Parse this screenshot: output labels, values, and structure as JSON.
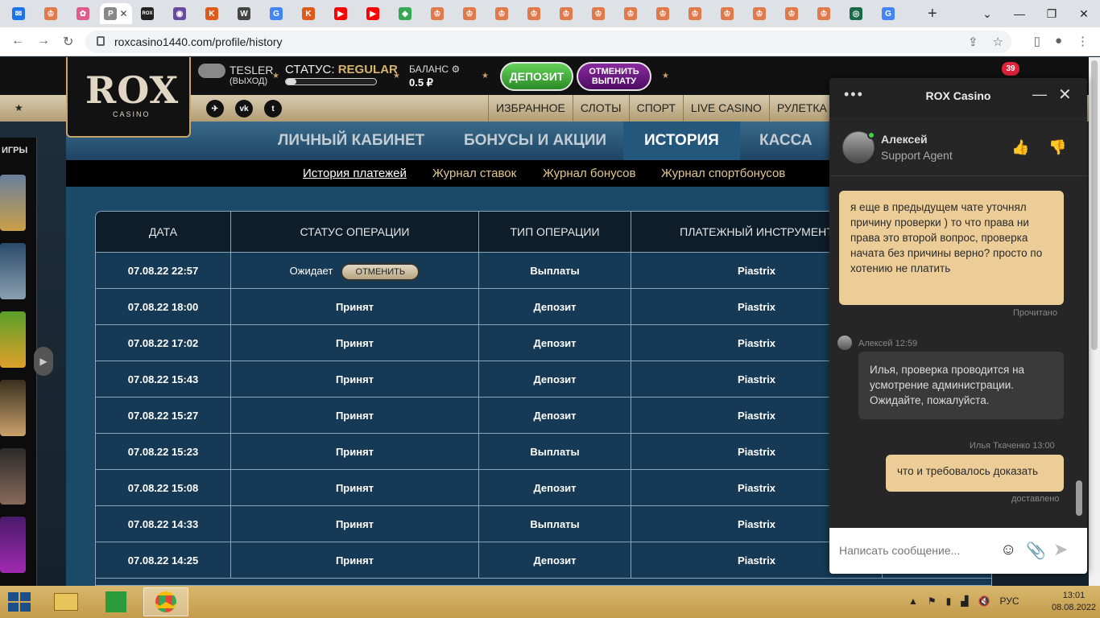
{
  "browser": {
    "tabs": [
      {
        "icon": "mail-icon",
        "color": "#1a73e8",
        "glyph": "✉"
      },
      {
        "icon": "crown-icon",
        "color": "#e07a4a",
        "glyph": "♔"
      },
      {
        "icon": "flower-icon",
        "color": "#e05a8a",
        "glyph": "✿"
      },
      {
        "icon": "active-tab-icon",
        "color": "#888",
        "glyph": "Р",
        "active": true
      },
      {
        "icon": "rox-icon",
        "color": "#222",
        "glyph": "ROX"
      },
      {
        "icon": "avatar-icon",
        "color": "#6a4aa0",
        "glyph": "◉"
      },
      {
        "icon": "k-icon",
        "color": "#e05a1a",
        "glyph": "K"
      },
      {
        "icon": "wikipedia-icon",
        "color": "#444",
        "glyph": "W"
      },
      {
        "icon": "google-icon",
        "color": "#4285f4",
        "glyph": "G"
      },
      {
        "icon": "k-icon",
        "color": "#e05a1a",
        "glyph": "K"
      },
      {
        "icon": "youtube-icon",
        "color": "#ff0000",
        "glyph": "▶"
      },
      {
        "icon": "youtube-icon",
        "color": "#ff0000",
        "glyph": "▶"
      },
      {
        "icon": "maps-icon",
        "color": "#34a853",
        "glyph": "◆"
      },
      {
        "icon": "crown-icon",
        "color": "#e07a4a",
        "glyph": "♔"
      },
      {
        "icon": "crown-icon",
        "color": "#e07a4a",
        "glyph": "♔"
      },
      {
        "icon": "crown-icon",
        "color": "#e07a4a",
        "glyph": "♔"
      },
      {
        "icon": "crown-icon",
        "color": "#e07a4a",
        "glyph": "♔"
      },
      {
        "icon": "crown-icon",
        "color": "#e07a4a",
        "glyph": "♔"
      },
      {
        "icon": "crown-icon",
        "color": "#e07a4a",
        "glyph": "♔"
      },
      {
        "icon": "crown-icon",
        "color": "#e07a4a",
        "glyph": "♔"
      },
      {
        "icon": "crown-icon",
        "color": "#e07a4a",
        "glyph": "♔"
      },
      {
        "icon": "crown-icon",
        "color": "#e07a4a",
        "glyph": "♔"
      },
      {
        "icon": "crown-icon",
        "color": "#e07a4a",
        "glyph": "♔"
      },
      {
        "icon": "crown-icon",
        "color": "#e07a4a",
        "glyph": "♔"
      },
      {
        "icon": "crown-icon",
        "color": "#e07a4a",
        "glyph": "♔"
      },
      {
        "icon": "crown-icon",
        "color": "#e07a4a",
        "glyph": "♔"
      },
      {
        "icon": "app-icon",
        "color": "#1a6a4a",
        "glyph": "◎"
      },
      {
        "icon": "google-icon",
        "color": "#4285f4",
        "glyph": "G"
      }
    ],
    "active_tab_label": "Р",
    "new_tab": "+",
    "url": "roxcasino1440.com/profile/history"
  },
  "site": {
    "logo": "ROX",
    "logo_sub": "CASINO",
    "user_name": "TESLER",
    "user_exit": "(ВЫХОД)",
    "status_label": "СТАТУС:",
    "status_value": "REGULAR",
    "status_progress": 0.12,
    "balance_label": "БАЛАНС",
    "balance_value": "0.5 ₽",
    "deposit_btn": "ДЕПОЗИТ",
    "cancel_btn_1": "ОТМЕНИТЬ",
    "cancel_btn_2": "ВЫПЛАТУ",
    "social": [
      "telegram-icon",
      "vk-icon",
      "twitter-icon"
    ],
    "menu": [
      "ИЗБРАННОЕ",
      "СЛОТЫ",
      "СПОРТ",
      "LIVE CASINO",
      "РУЛЕТКА"
    ],
    "sections": [
      "ЛИЧНЫЙ КАБИНЕТ",
      "БОНУСЫ И АКЦИИ",
      "ИСТОРИЯ",
      "КАССА"
    ],
    "subnav": [
      "История платежей",
      "Журнал ставок",
      "Журнал бонусов",
      "Журнал спортбонусов"
    ],
    "rail_title": "ИГРЫ"
  },
  "table": {
    "headers": [
      "ДАТА",
      "СТАТУС ОПЕРАЦИИ",
      "ТИП ОПЕРАЦИИ",
      "ПЛАТЕЖНЫЙ ИНСТРУМЕНТ"
    ],
    "cancel_label": "ОТМЕНИТЬ",
    "rows": [
      {
        "date": "07.08.22 22:57",
        "status": "Ожидает",
        "type": "Выплаты",
        "tool": "Piastrix",
        "cancellable": true
      },
      {
        "date": "07.08.22 18:00",
        "status": "Принят",
        "type": "Депозит",
        "tool": "Piastrix"
      },
      {
        "date": "07.08.22 17:02",
        "status": "Принят",
        "type": "Депозит",
        "tool": "Piastrix"
      },
      {
        "date": "07.08.22 15:43",
        "status": "Принят",
        "type": "Депозит",
        "tool": "Piastrix"
      },
      {
        "date": "07.08.22 15:27",
        "status": "Принят",
        "type": "Депозит",
        "tool": "Piastrix"
      },
      {
        "date": "07.08.22 15:23",
        "status": "Принят",
        "type": "Выплаты",
        "tool": "Piastrix"
      },
      {
        "date": "07.08.22 15:08",
        "status": "Принят",
        "type": "Депозит",
        "tool": "Piastrix"
      },
      {
        "date": "07.08.22 14:33",
        "status": "Принят",
        "type": "Выплаты",
        "tool": "Piastrix"
      },
      {
        "date": "07.08.22 14:25",
        "status": "Принят",
        "type": "Депозит",
        "tool": "Piastrix"
      }
    ]
  },
  "chat": {
    "title": "ROX Casino",
    "agent_name": "Алексей",
    "agent_role": "Support Agent",
    "msg1": "я еще в предыдущем чате уточнял причину проверки ) то что права ни права это второй вопрос, проверка начата без причины верно? просто по хотению не платить",
    "msg1_status": "Прочитано",
    "msg2_meta": "Алексей 12:59",
    "msg2": "Илья, проверка проводится на усмотрение администрации. Ожидайте, пожалуйста.",
    "msg3_meta": "Илья Ткаченко 13:00",
    "msg3": "что и требовалось доказать",
    "msg3_status": "доставлено",
    "input_placeholder": "Написать сообщение..."
  },
  "notif_count": "39",
  "taskbar": {
    "lang": "РУС",
    "time": "13:01",
    "date": "08.08.2022"
  }
}
